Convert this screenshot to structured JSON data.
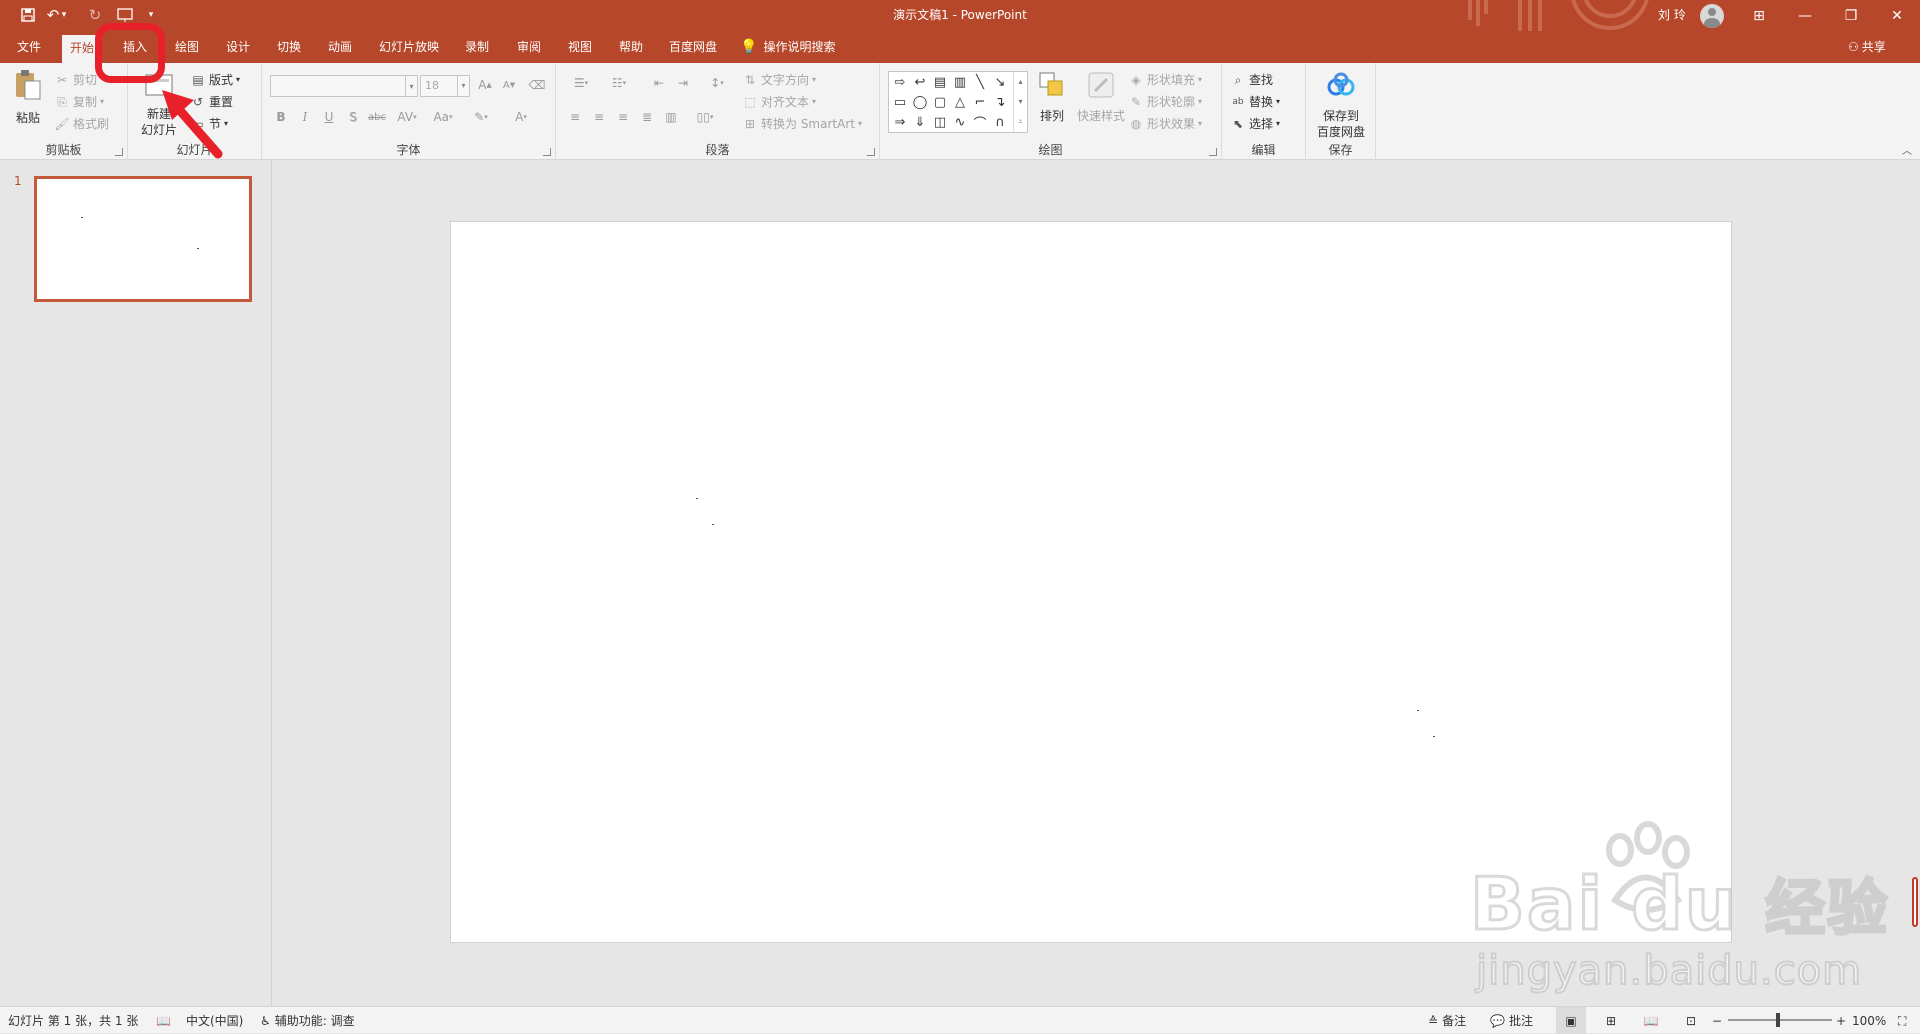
{
  "window": {
    "doc_title": "演示文稿1  -  PowerPoint",
    "user_name": "刘 玲",
    "quick_access": [
      "save-icon",
      "undo-icon",
      "redo-icon",
      "start-from-beginning-icon",
      "customize-qat-icon"
    ],
    "controls": {
      "minimize": "—",
      "maximize": "❐",
      "close": "✕",
      "ribbon_display": "⊞"
    }
  },
  "tabs": {
    "file": "文件",
    "home": "开始",
    "insert": "插入",
    "draw": "绘图",
    "design": "设计",
    "transitions": "切换",
    "animations": "动画",
    "slideshow": "幻灯片放映",
    "record": "录制",
    "review": "审阅",
    "view": "视图",
    "help": "帮助",
    "baidu": "百度网盘",
    "tell_me": "操作说明搜索",
    "share": "共享",
    "active": "home"
  },
  "ribbon": {
    "clipboard": {
      "label": "剪贴板",
      "paste": "粘贴",
      "cut": "剪切",
      "copy": "复制",
      "format_painter": "格式刷"
    },
    "slides": {
      "label": "幻灯片",
      "new_slide_l1": "新建",
      "new_slide_l2": "幻灯片",
      "layout": "版式",
      "reset": "重置",
      "section": "节"
    },
    "font": {
      "label": "字体",
      "font_name": "",
      "font_size": "18",
      "bold": "B",
      "italic": "I",
      "underline": "U",
      "shadow": "S",
      "strike": "abc",
      "spacing": "AV",
      "case": "Aa",
      "color": "A",
      "grow": "A",
      "shrink": "A"
    },
    "paragraph": {
      "label": "段落",
      "text_direction": "文字方向",
      "align_text": "对齐文本",
      "smartart": "转换为 SmartArt"
    },
    "drawing": {
      "label": "绘图",
      "arrange": "排列",
      "quick_styles": "快速样式",
      "shape_fill": "形状填充",
      "shape_outline": "形状轮廓",
      "shape_effects": "形状效果"
    },
    "editing": {
      "label": "编辑",
      "find": "查找",
      "replace": "替换",
      "select": "选择"
    },
    "save": {
      "label": "保存",
      "save_to_l1": "保存到",
      "save_to_l2": "百度网盘"
    }
  },
  "thumbnails": {
    "slide_number": "1"
  },
  "statusbar": {
    "slide_info": "幻灯片 第 1 张，共 1 张",
    "language": "中文(中国)",
    "accessibility": "辅助功能: 调查",
    "notes": "备注",
    "comments": "批注",
    "zoom": "100%",
    "zoom_level": 1.0
  },
  "watermark": {
    "brand": "Bai  du",
    "brand_cn": "经验",
    "url": "jingyan.baidu.com"
  },
  "colors": {
    "accent": "#b7472a",
    "annotation": "#e8202a"
  }
}
